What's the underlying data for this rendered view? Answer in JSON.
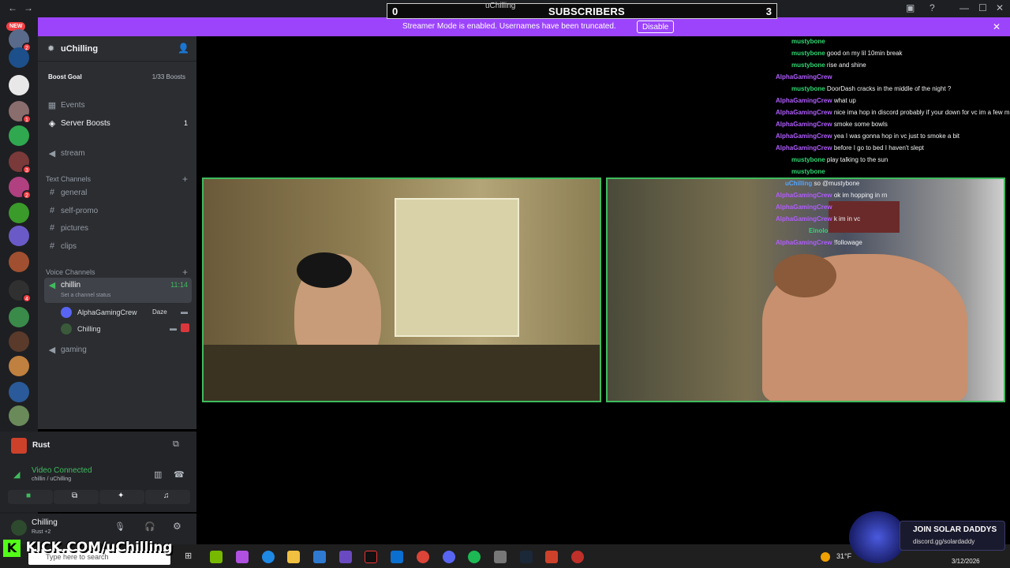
{
  "topbar": {
    "subscribers_left": "0",
    "subscribers_label": "SUBSCRIBERS",
    "subscribers_right": "3",
    "streamer_user": "uChilling"
  },
  "banner": {
    "text": "Streamer Mode is enabled. Usernames have been truncated.",
    "button": "Disable"
  },
  "rail": {
    "new_label": "NEW",
    "badges": [
      "2",
      "1",
      "3",
      "2",
      "4"
    ]
  },
  "guild": {
    "name": "uChilling",
    "boost_goal": "Boost Goal",
    "boost_count": "1/33 Boosts"
  },
  "sidebar": {
    "events": "Events",
    "server_boosts": "Server Boosts",
    "server_boosts_count": "1",
    "stream": "stream",
    "text_category": "Text Channels",
    "text_channels": [
      "general",
      "self-promo",
      "pictures",
      "clips"
    ],
    "voice_category": "Voice Channels",
    "voice_channel": "chillin",
    "voice_time": "11:14",
    "voice_status": "Set a channel status",
    "members": [
      {
        "name": "AlphaGamingCrew",
        "tag": "Daze"
      },
      {
        "name": "Chilling"
      }
    ],
    "gaming_channel": "gaming"
  },
  "activity": {
    "game": "Rust"
  },
  "voice_panel": {
    "status": "Video Connected",
    "location": "chillin / uChilling"
  },
  "user_panel": {
    "name": "Chilling",
    "sub": "Rust +2"
  },
  "chat": [
    {
      "user": "mustybone",
      "text": "",
      "cls": "u1"
    },
    {
      "user": "mustybone",
      "text": "good on my lil 10min break",
      "cls": "u1"
    },
    {
      "user": "mustybone",
      "text": "rise and shine",
      "cls": "u1"
    },
    {
      "user": "AlphaGamingCrew",
      "text": "",
      "cls": "u3"
    },
    {
      "user": "mustybone",
      "text": "DoorDash cracks in the middle of the night ?",
      "cls": "u1"
    },
    {
      "user": "AlphaGamingCrew",
      "text": "what up",
      "cls": "u3"
    },
    {
      "user": "AlphaGamingCrew",
      "text": "nice ima hop in discord probably if your down for vc im a few m",
      "cls": "u3"
    },
    {
      "user": "AlphaGamingCrew",
      "text": "smoke some bowls",
      "cls": "u3"
    },
    {
      "user": "AlphaGamingCrew",
      "text": "yea I was gonna hop in vc just to smoke a bit",
      "cls": "u3"
    },
    {
      "user": "AlphaGamingCrew",
      "text": "before I go to bed I haven't slept",
      "cls": "u3"
    },
    {
      "user": "mustybone",
      "text": "play talking to the sun",
      "cls": "u1"
    },
    {
      "user": "mustybone",
      "text": "",
      "cls": "u1"
    },
    {
      "user": "uChilling",
      "text": "so @mustybone",
      "cls": "u2"
    },
    {
      "user": "AlphaGamingCrew",
      "text": "ok im hopping in rn",
      "cls": "u3"
    },
    {
      "user": "AlphaGamingCrew",
      "text": "",
      "cls": "u3"
    },
    {
      "user": "AlphaGamingCrew",
      "text": "k im in vc",
      "cls": "u3"
    },
    {
      "user": "Einolo",
      "text": "",
      "cls": "u1"
    },
    {
      "user": "AlphaGamingCrew",
      "text": "!followage",
      "cls": "u3"
    }
  ],
  "overlays": {
    "kick_url": "KICK.COM/uChilling",
    "solar_title": "JOIN SOLAR DADDYS",
    "solar_link": "discord.gg/solardaddy"
  },
  "taskbar": {
    "search_placeholder": "Type here to search",
    "weather": "31°F",
    "date": "3/12/2026"
  }
}
